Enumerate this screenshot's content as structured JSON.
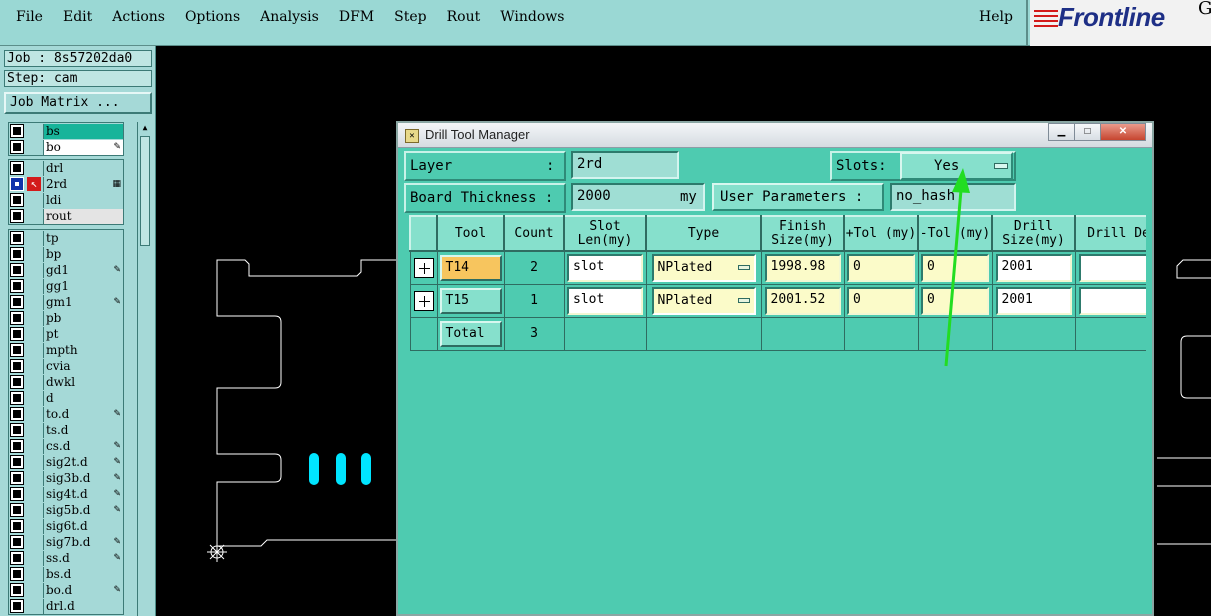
{
  "menubar": {
    "items": [
      "File",
      "Edit",
      "Actions",
      "Options",
      "Analysis",
      "DFM",
      "Step",
      "Rout",
      "Windows"
    ],
    "help": "Help"
  },
  "logo": {
    "text": "Frontline",
    "trailing": "G"
  },
  "left": {
    "job": "Job : 8s57202da0",
    "step": "Step: cam",
    "job_matrix": "Job Matrix ...",
    "groups": [
      [
        "bs",
        "bo"
      ],
      [
        "drl",
        "2rd",
        "ldi",
        "rout"
      ],
      [
        "tp",
        "bp",
        "gd1",
        "gg1",
        "gm1",
        "pb",
        "pt",
        "mpth",
        "cvia",
        "dwkl",
        "d",
        "to.d",
        "ts.d",
        "cs.d",
        "sig2t.d",
        "sig3b.d",
        "sig4t.d",
        "sig5b.d",
        "sig6t.d",
        "sig7b.d",
        "ss.d",
        "bs.d",
        "bo.d",
        "drl.d"
      ]
    ]
  },
  "dialog": {
    "title": "Drill Tool Manager",
    "layer_label": "Layer",
    "layer_colon": ":",
    "layer_value": "2rd",
    "slots_label": "Slots:",
    "slots_value": "Yes",
    "board_thickness_label": "Board Thickness :",
    "board_thickness_value": "2000",
    "unit": "my",
    "user_params_label": "User Parameters :",
    "user_params_value": "no_hash",
    "columns": [
      "",
      "Tool",
      "Count",
      "Slot Len(my)",
      "Type",
      "Finish Size(my)",
      "+Tol (my)",
      "-Tol (my)",
      "Drill Size(my)",
      "Drill Des"
    ],
    "rows": [
      {
        "tool": "T14",
        "count": "2",
        "slot_len": "slot",
        "type": "NPlated",
        "finish": "1998.98",
        "ptol": "0",
        "mtol": "0",
        "drill": "2001",
        "des": ""
      },
      {
        "tool": "T15",
        "count": "1",
        "slot_len": "slot",
        "type": "NPlated",
        "finish": "2001.52",
        "ptol": "0",
        "mtol": "0",
        "drill": "2001",
        "des": ""
      }
    ],
    "total": {
      "label": "Total",
      "count": "3"
    }
  },
  "colors": {
    "panel": "#a5d9d7",
    "dialog": "#4ecbb0",
    "accent_arrow": "#22dd22",
    "slot_cyan": "#00e5ff",
    "active_tool": "#f7c55e"
  }
}
